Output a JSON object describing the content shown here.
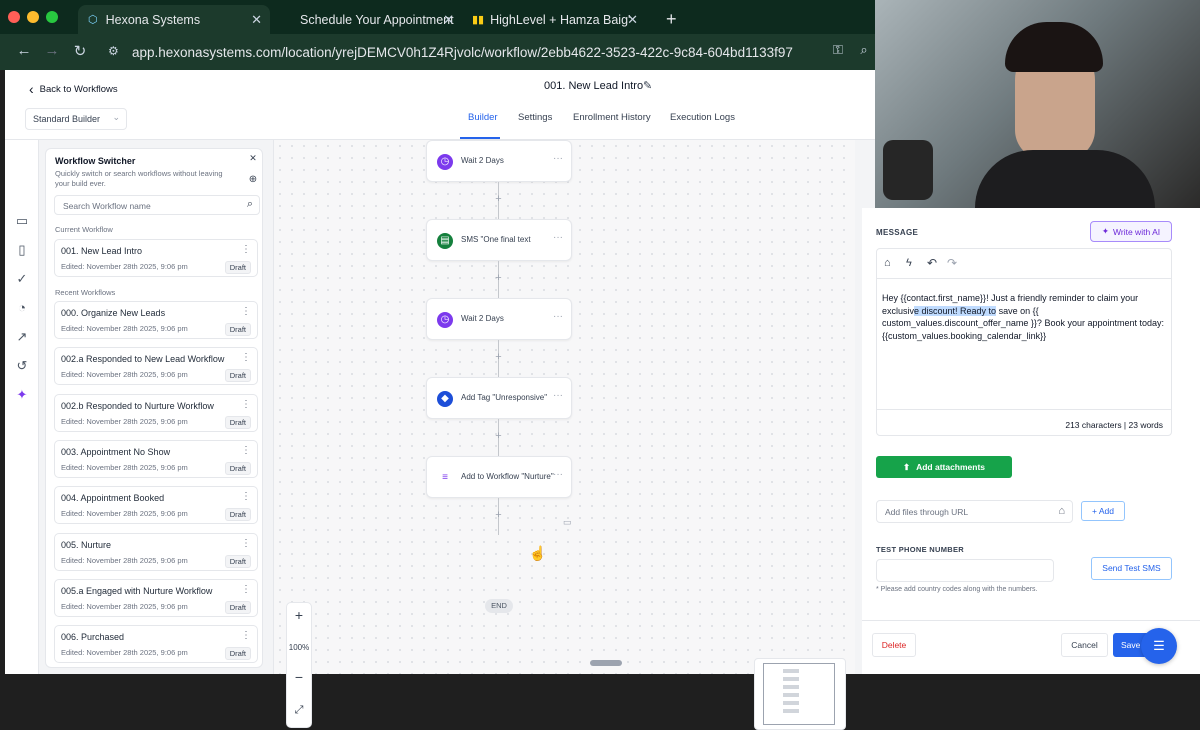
{
  "browser": {
    "tabs": [
      {
        "label": "Hexona Systems",
        "active": true
      },
      {
        "label": "Schedule Your Appointment",
        "active": false
      },
      {
        "label": "HighLevel + Hamza Baig's Sp",
        "active": false
      }
    ],
    "url": "app.hexonasystems.com/location/yrejDEMCV0h1Z4Rjvolc/workflow/2ebb4622-3523-422c-9c84-604bd1133f97",
    "colors": {
      "tabbar": "#0d2a1e",
      "addressbar": "#1c3a2c"
    }
  },
  "header": {
    "back_label": "Back to Workflows",
    "workflow_title": "001. New Lead Intro",
    "builder_select": "Standard Builder",
    "tabs": [
      {
        "label": "Builder",
        "active": true
      },
      {
        "label": "Settings",
        "active": false
      },
      {
        "label": "Enrollment History",
        "active": false
      },
      {
        "label": "Execution Logs",
        "active": false
      }
    ]
  },
  "switcher": {
    "title": "Workflow Switcher",
    "description": "Quickly switch or search workflows without leaving your build ever.",
    "search_placeholder": "Search Workflow name",
    "current_label": "Current Workflow",
    "recent_label": "Recent Workflows",
    "current": {
      "name": "001. New Lead Intro",
      "edited": "Edited: November 28th 2025, 9:06 pm",
      "status": "Draft"
    },
    "recent": [
      {
        "name": "000. Organize New Leads",
        "edited": "Edited: November 28th 2025, 9:06 pm",
        "status": "Draft"
      },
      {
        "name": "002.a Responded to New Lead Workflow",
        "edited": "Edited: November 28th 2025, 9:06 pm",
        "status": "Draft"
      },
      {
        "name": "002.b Responded to Nurture Workflow",
        "edited": "Edited: November 28th 2025, 9:06 pm",
        "status": "Draft"
      },
      {
        "name": "003. Appointment No Show",
        "edited": "Edited: November 28th 2025, 9:06 pm",
        "status": "Draft"
      },
      {
        "name": "004. Appointment Booked",
        "edited": "Edited: November 28th 2025, 9:06 pm",
        "status": "Draft"
      },
      {
        "name": "005. Nurture",
        "edited": "Edited: November 28th 2025, 9:06 pm",
        "status": "Draft"
      },
      {
        "name": "005.a Engaged with Nurture Workflow",
        "edited": "Edited: November 28th 2025, 9:06 pm",
        "status": "Draft"
      },
      {
        "name": "006. Purchased",
        "edited": "Edited: November 28th 2025, 9:06 pm",
        "status": "Draft"
      }
    ]
  },
  "canvas": {
    "nodes": [
      {
        "label": "Wait 2 Days",
        "icon": "clock-icon",
        "color": "#7c3aed"
      },
      {
        "label": "SMS \"One final text",
        "icon": "message-icon",
        "color": "#15803d"
      },
      {
        "label": "Wait 2 Days",
        "icon": "clock-icon",
        "color": "#7c3aed"
      },
      {
        "label": "Add Tag \"Unresponsive\"",
        "icon": "tag-icon",
        "color": "#1d4ed8"
      },
      {
        "label": "Add to Workflow \"Nurture\"",
        "icon": "workflow-add-icon",
        "color": "#7c3aed"
      }
    ],
    "end_label": "END",
    "zoom": "100%"
  },
  "message_panel": {
    "message_label": "MESSAGE",
    "write_ai_label": "Write with AI",
    "body_before": "Hey {{contact.first_name}}! Just a friendly reminder to claim your exclusiv",
    "body_highlight": "e discount! Ready to",
    "body_after": " save on {{ custom_values.discount_offer_name }}? Book your appointment today: {{custom_values.booking_calendar_link}}",
    "counter": "213 characters | 23 words",
    "attach_label": "Add attachments",
    "url_placeholder": "Add files through URL",
    "add_label": "+ Add",
    "test_phone_label": "TEST PHONE NUMBER",
    "send_test_label": "Send Test SMS",
    "phone_hint": "* Please add country codes along with the numbers.",
    "delete_label": "Delete",
    "cancel_label": "Cancel",
    "save_label": "Save",
    "colors": {
      "accent": "#2563eb",
      "green": "#16a34a",
      "danger": "#dc2626",
      "ai": "#7c3aed"
    }
  }
}
